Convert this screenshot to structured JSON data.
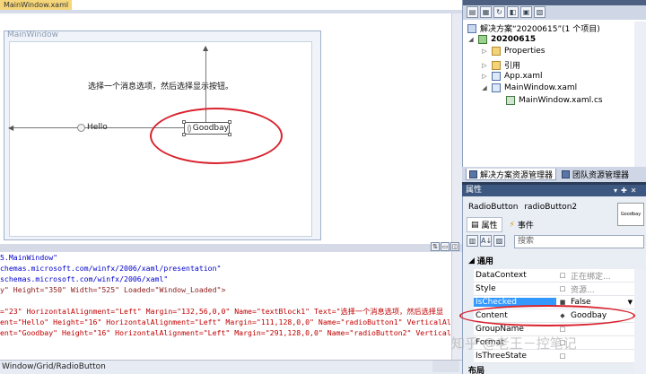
{
  "designer": {
    "doc_tab": "MainWindow.xaml",
    "window_title": "MainWindow",
    "text_block": "选择一个消息选项，然后选择显示按钮。",
    "radio1_label": "Hello",
    "radio2_label": "Goodbay"
  },
  "xaml": {
    "lines": [
      "5.MainWindow\"",
      "chemas.microsoft.com/winfx/2006/xaml/presentation\"",
      "schemas.microsoft.com/winfx/2006/xaml\"",
      "y\" Height=\"350\" Width=\"525\" Loaded=\"Window_Loaded\">",
      "",
      "=\"23\" HorizontalAlignment=\"Left\" Margin=\"132,56,0,0\" Name=\"textBlock1\" Text=\"选择一个消息选项，然后选择显",
      "ent=\"Hello\" Height=\"16\" HorizontalAlignment=\"Left\" Margin=\"111,128,0,0\" Name=\"radioButton1\" VerticalAlign",
      "ent=\"Goodbay\" Height=\"16\" HorizontalAlignment=\"Left\" Margin=\"291,128,0,0\" Name=\"radioButton2\" VerticalAli"
    ]
  },
  "statusbar": {
    "breadcrumb": "Window/Grid/RadioButton"
  },
  "solution": {
    "items": [
      {
        "label": "解决方案“20200615”(1 个项目)",
        "icon": "solution-icon"
      },
      {
        "label": "20200615",
        "icon": "project-icon"
      },
      {
        "label": "Properties",
        "icon": "folder-icon"
      },
      {
        "label": "引用",
        "icon": "references-icon"
      },
      {
        "label": "App.xaml",
        "icon": "xaml-file-icon"
      },
      {
        "label": "MainWindow.xaml",
        "icon": "xaml-file-icon"
      },
      {
        "label": "MainWindow.xaml.cs",
        "icon": "cs-file-icon"
      }
    ],
    "tab_solution": "解决方案资源管理器",
    "tab_team": "团队资源管理器"
  },
  "properties": {
    "header": "属性",
    "type": "RadioButton",
    "name": "radioButton2",
    "thumb_text": "Goodbay",
    "tab_props": "属性",
    "tab_events": "事件",
    "search_placeholder": "搜索",
    "category_common": "通用",
    "category_layout": "布局",
    "rows": [
      {
        "name": "DataContext",
        "value": "正在绑定..."
      },
      {
        "name": "Style",
        "value": "资源..."
      },
      {
        "name": "IsChecked",
        "value": "False"
      },
      {
        "name": "Content",
        "value": "Goodbay"
      },
      {
        "name": "GroupName",
        "value": ""
      },
      {
        "name": "Format",
        "value": ""
      },
      {
        "name": "IsThreeState",
        "value": ""
      }
    ]
  },
  "watermark": "知乎 @老王－控笔记",
  "colors": {
    "annotation": "#d9232e",
    "selection": "#3399ff",
    "panel_header": "#3c5780"
  }
}
